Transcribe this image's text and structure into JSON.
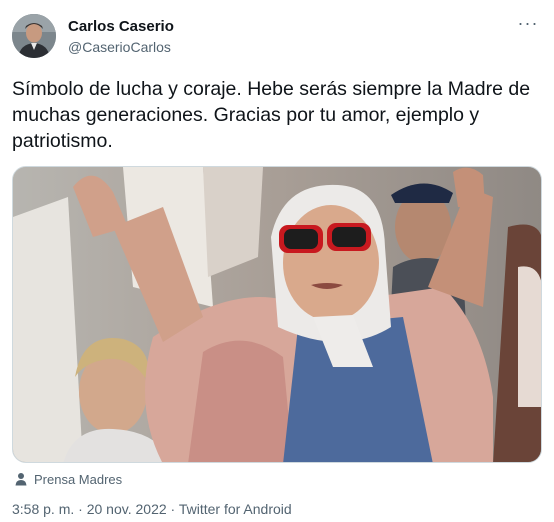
{
  "author": {
    "name": "Carlos Caserio",
    "handle": "@CaserioCarlos"
  },
  "more_icon": "more-horizontal-icon",
  "tweet_text": "Símbolo de lucha y coraje. Hebe serás siempre la Madre de muchas generaciones. Gracias por tu amor, ejemplo y patriotismo.",
  "media": {
    "tag_icon": "person-icon",
    "tag_label": "Prensa Madres"
  },
  "meta": {
    "time": "3:58 p. m.",
    "separator": " · ",
    "date": "20 nov. 2022",
    "source": "Twitter for Android"
  },
  "colors": {
    "text": "#0f1419",
    "secondary": "#536471",
    "border": "#cfd9de"
  }
}
